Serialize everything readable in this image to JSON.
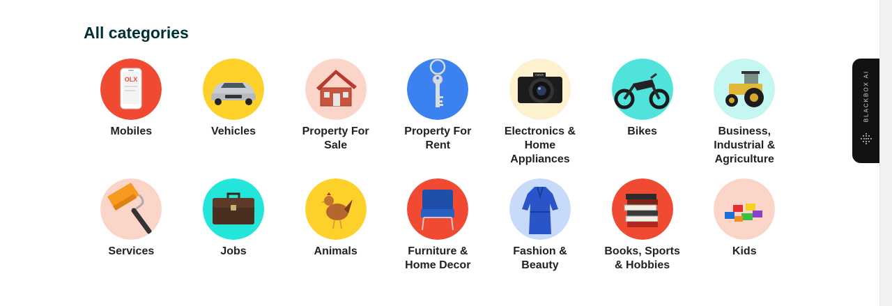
{
  "section": {
    "title": "All categories"
  },
  "categories": [
    {
      "label": "Mobiles",
      "icon": "mobile-phone-icon"
    },
    {
      "label": "Vehicles",
      "icon": "car-icon"
    },
    {
      "label": "Property For Sale",
      "icon": "house-icon"
    },
    {
      "label": "Property For Rent",
      "icon": "key-icon"
    },
    {
      "label": "Electronics & Home Appliances",
      "icon": "camera-icon"
    },
    {
      "label": "Bikes",
      "icon": "motorbike-icon"
    },
    {
      "label": "Business, Industrial & Agriculture",
      "icon": "tractor-icon"
    },
    {
      "label": "Services",
      "icon": "paint-roller-icon"
    },
    {
      "label": "Jobs",
      "icon": "briefcase-icon"
    },
    {
      "label": "Animals",
      "icon": "chicken-icon"
    },
    {
      "label": "Furniture & Home Decor",
      "icon": "armchair-icon"
    },
    {
      "label": "Fashion & Beauty",
      "icon": "dress-icon"
    },
    {
      "label": "Books, Sports & Hobbies",
      "icon": "books-icon"
    },
    {
      "label": "Kids",
      "icon": "toy-blocks-icon"
    }
  ],
  "sidebar_widget": {
    "label": "BLACKBOX AI"
  },
  "colors": {
    "heading": "#002f34",
    "mobiles_bg": "#f04a32",
    "vehicles_bg": "#fdd02a",
    "property_sale_bg": "#fcd5c9",
    "property_rent_bg": "#3b82f0",
    "electronics_bg": "#fdf1cf",
    "bikes_bg": "#4fe3db",
    "business_bg": "#c5f6f2",
    "services_bg": "#fcd5c9",
    "jobs_bg": "#23e5d9",
    "animals_bg": "#fdd02a",
    "furniture_bg": "#f04a32",
    "fashion_bg": "#c8daf9",
    "books_bg": "#f04a32",
    "kids_bg": "#fcd5c9"
  }
}
